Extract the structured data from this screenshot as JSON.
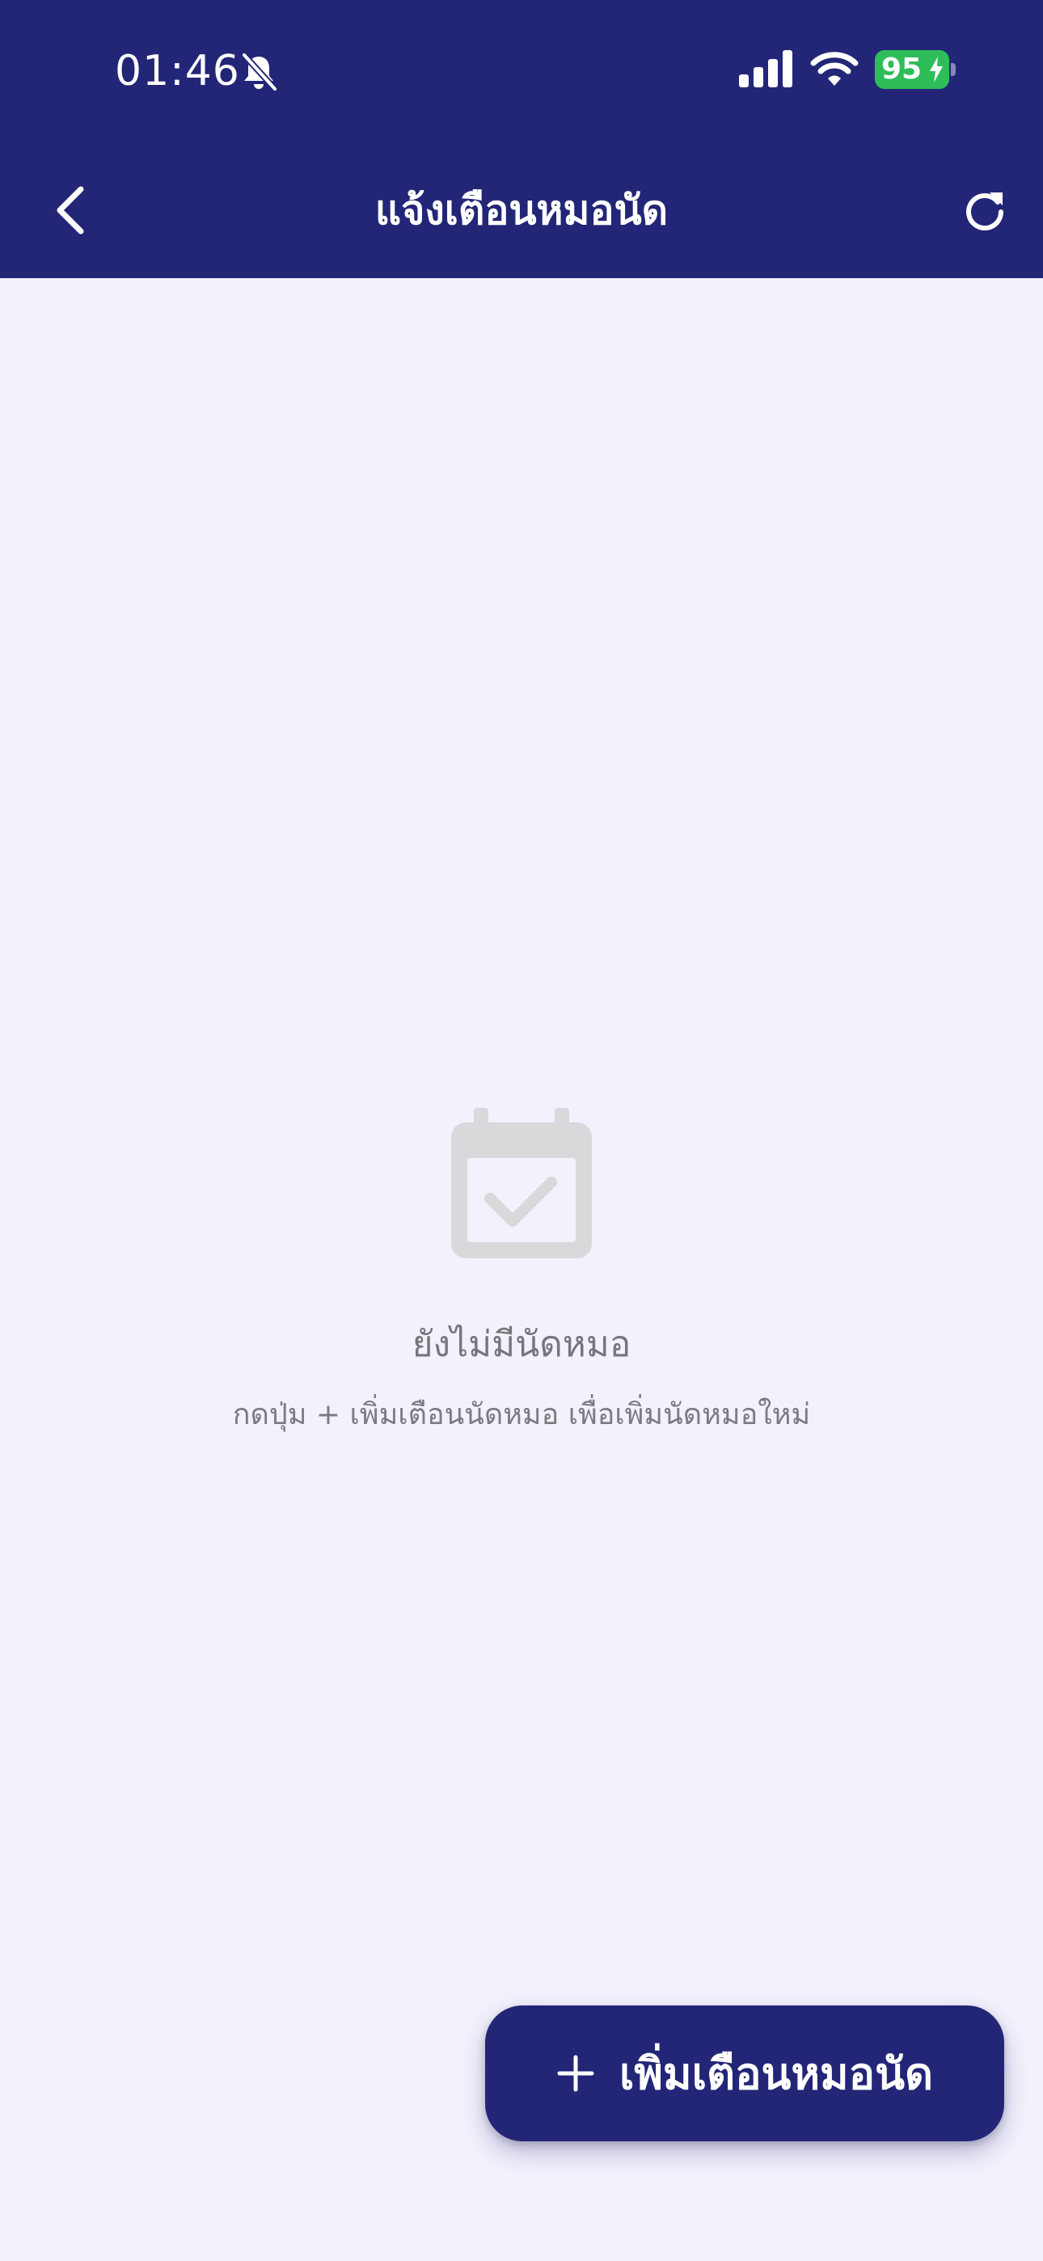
{
  "status_bar": {
    "time": "01:46",
    "battery": "95"
  },
  "header": {
    "title": "แจ้งเตือนหมอนัด"
  },
  "empty_state": {
    "title": "ยังไม่มีนัดหมอ",
    "hint": "กดปุ่ม + เพิ่มเตือนนัดหมอ เพื่อเพิ่มนัดหมอใหม่"
  },
  "fab": {
    "label": "เพิ่มเตือนหมอนัด"
  },
  "icons": {
    "status": [
      "bell-slash-icon",
      "cellular-signal-icon",
      "wifi-icon",
      "battery-icon"
    ],
    "header": [
      "chevron-left-icon",
      "refresh-icon"
    ],
    "empty": "calendar-check-icon",
    "fab": "plus-icon"
  },
  "colors": {
    "primary": "#232677",
    "background": "#f4f1fd",
    "battery": "#2ebd59",
    "muted_text": "#77767a",
    "empty_icon": "#d9d8da"
  }
}
